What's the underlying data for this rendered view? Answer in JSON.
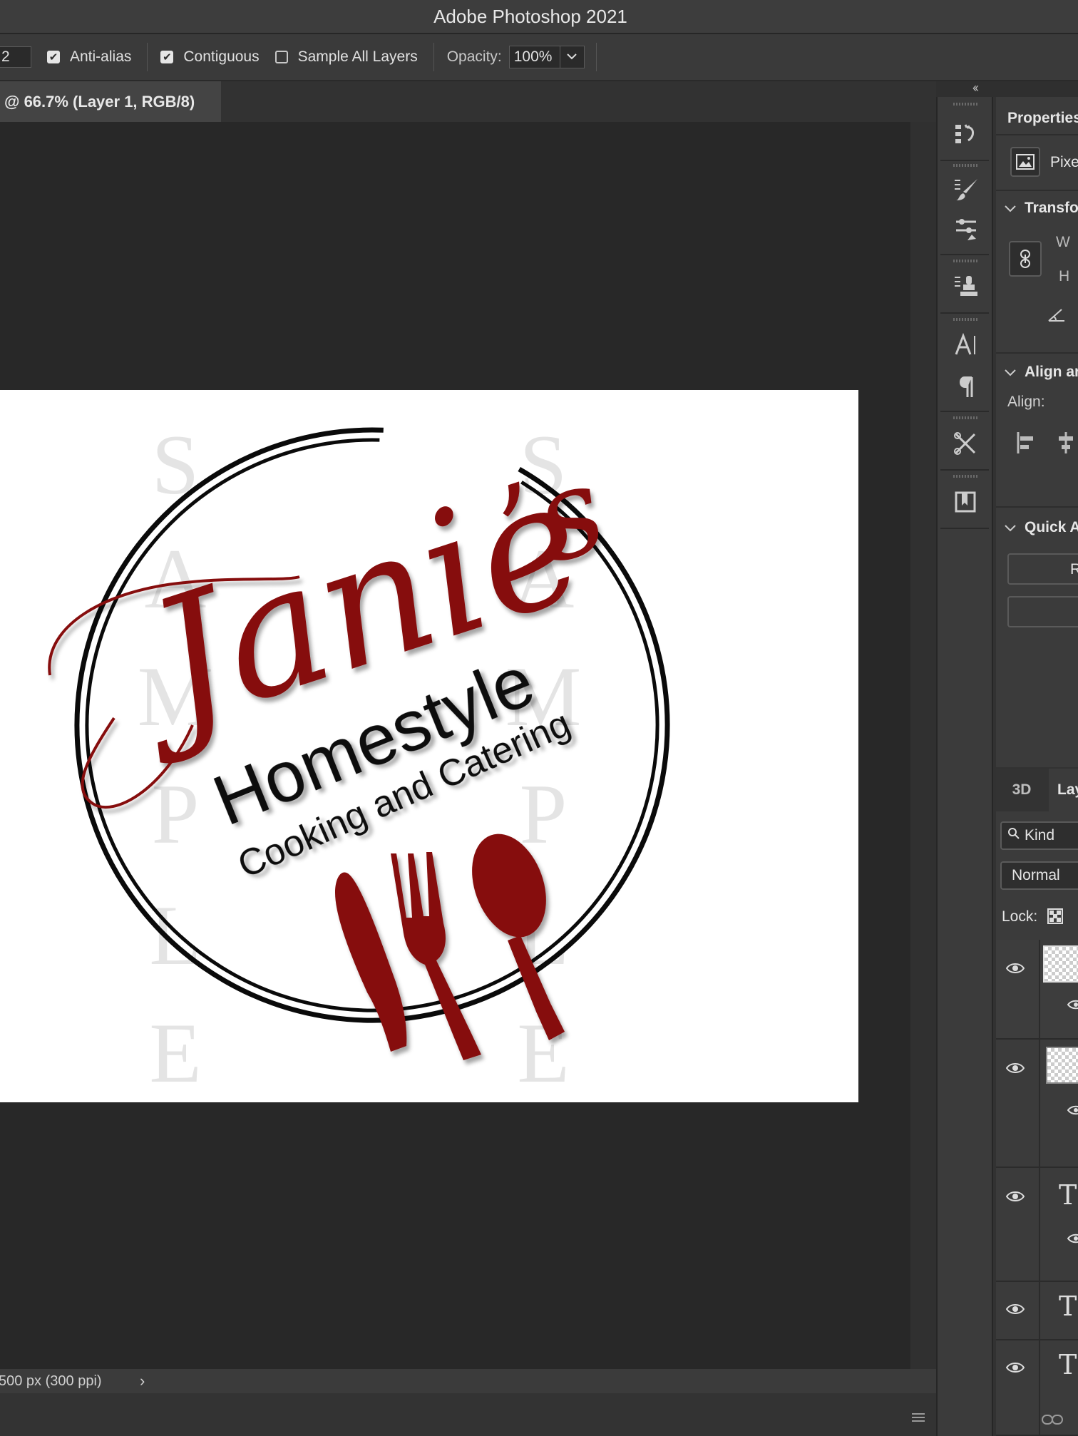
{
  "app": {
    "title": "Adobe Photoshop 2021"
  },
  "options_bar": {
    "tolerance_value": "2",
    "anti_alias": {
      "label": "Anti-alias",
      "checked": true
    },
    "contiguous": {
      "label": "Contiguous",
      "checked": true
    },
    "sample_all_layers": {
      "label": "Sample All Layers",
      "checked": false
    },
    "opacity_label": "Opacity:",
    "opacity_value": "100%"
  },
  "document_tab": {
    "label": "@ 66.7% (Layer 1, RGB/8)"
  },
  "artwork": {
    "watermark_letters": [
      "S",
      "A",
      "M",
      "P",
      "L",
      "E"
    ],
    "script_name": "Janie",
    "apostrophe_s": "’s",
    "homestyle": "Homestyle",
    "tagline": "Cooking and Catering",
    "brand_red": "#860c0c"
  },
  "status_bar": {
    "text": "500 px (300 ppi)",
    "arrow": "›"
  },
  "panel_strip": {
    "collapse": "‹‹"
  },
  "properties": {
    "title": "Properties",
    "pixel_layer": "Pixe",
    "transform": "Transfo",
    "w": "W",
    "h": "H",
    "align_section": "Align ar",
    "align_label": "Align:",
    "quick_actions": "Quick A",
    "quick_button": "R"
  },
  "layers_panel": {
    "tab_3d": "3D",
    "tab_layers": "Lay",
    "kind": "Kind",
    "blend_mode": "Normal",
    "lock": "Lock:",
    "text_layer_glyph": "T"
  }
}
